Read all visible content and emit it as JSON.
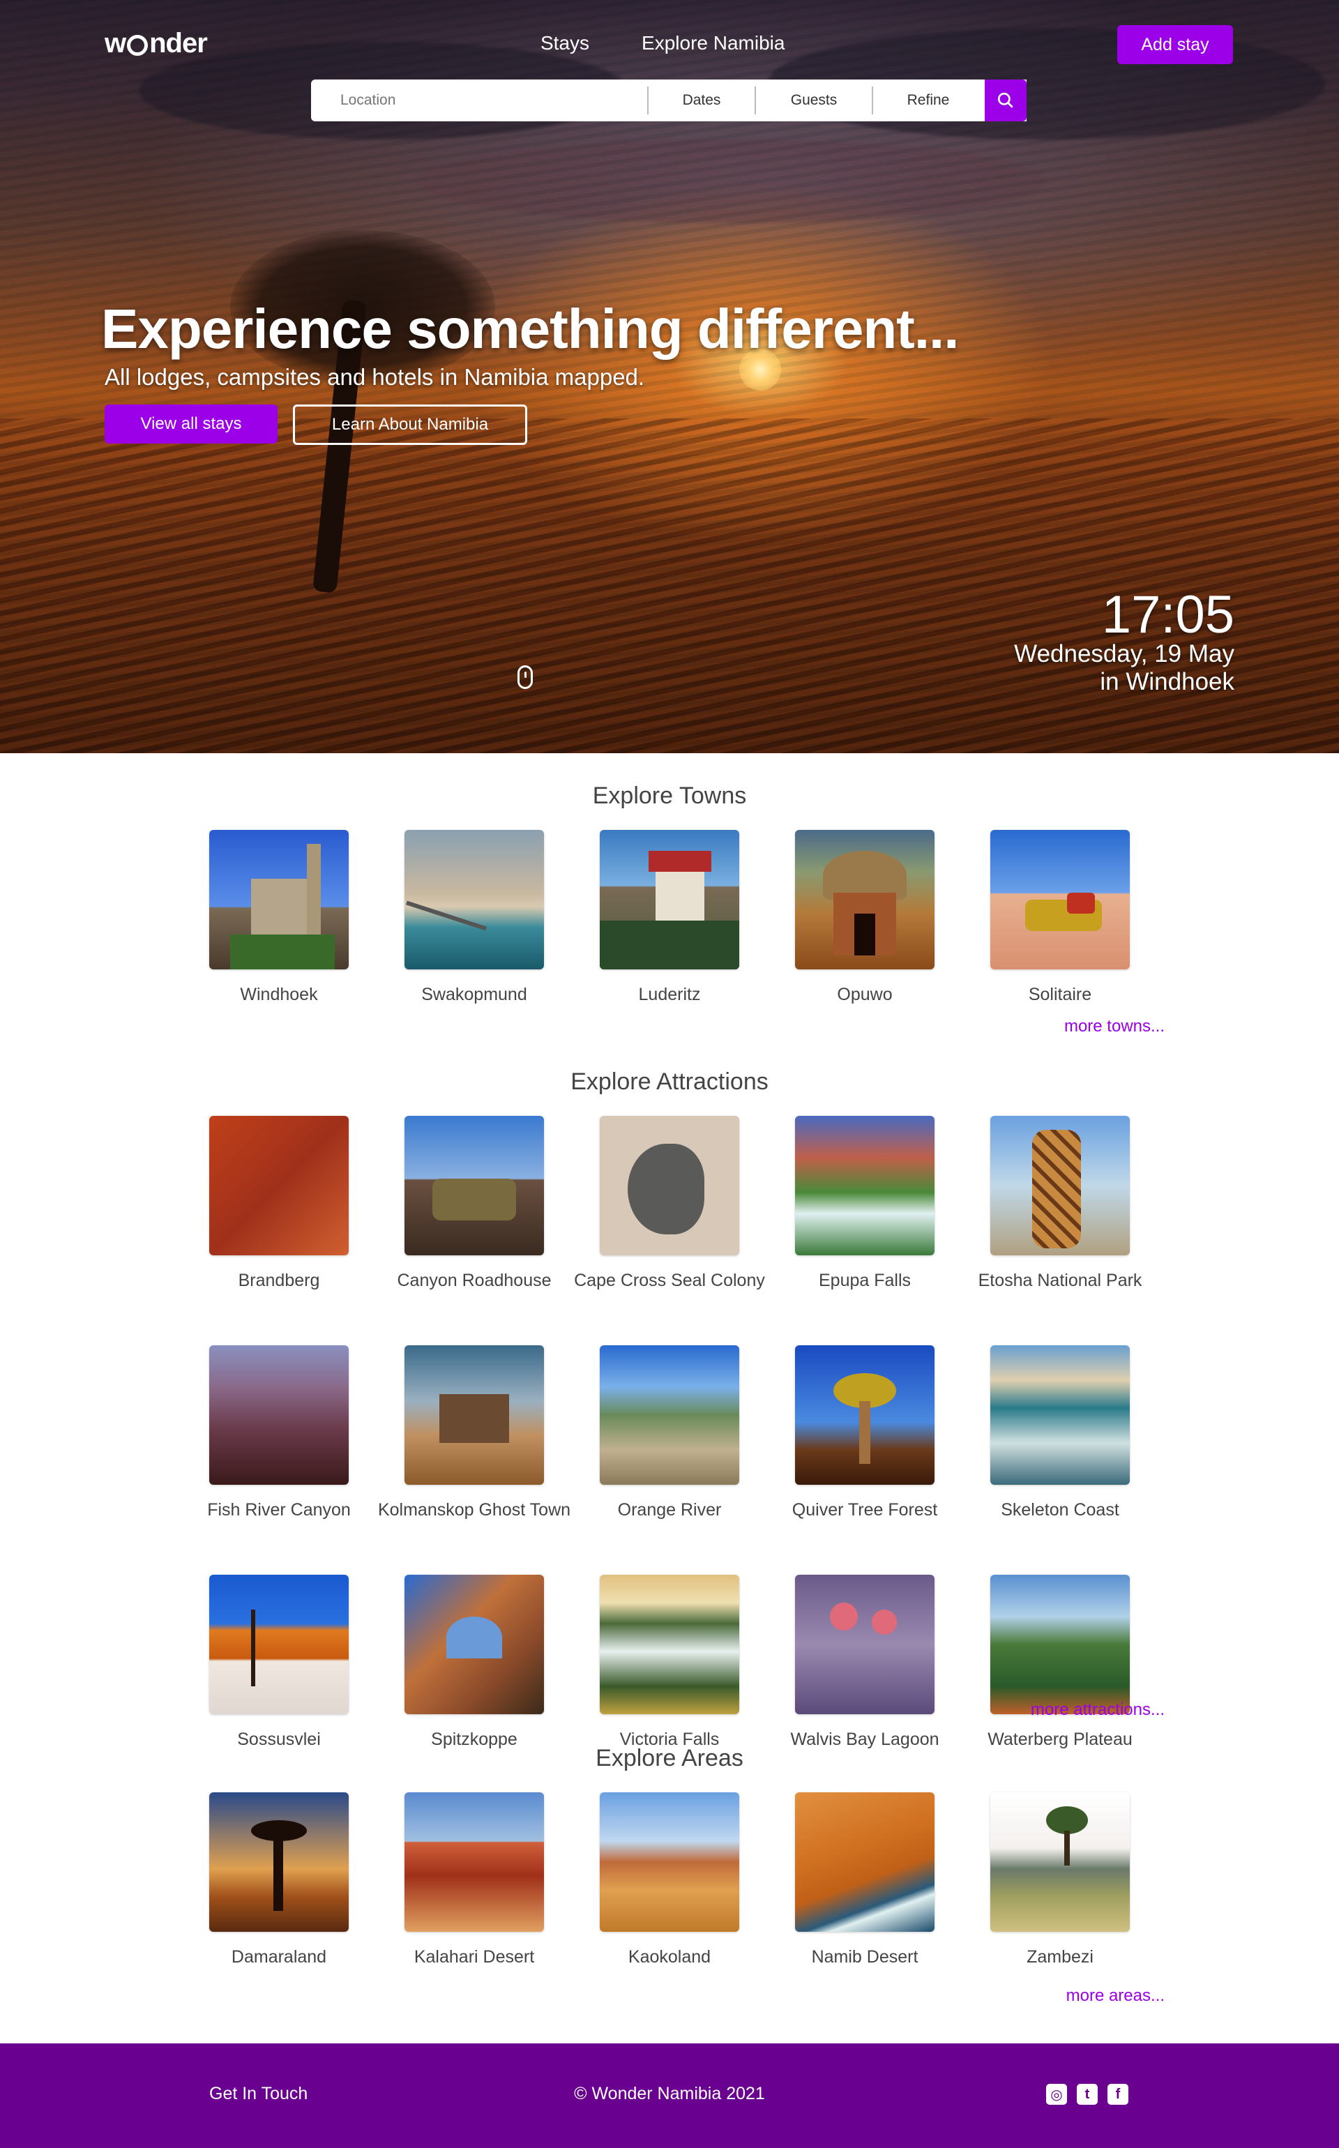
{
  "header": {
    "logo_text": "wonder",
    "nav": [
      "Stays",
      "Explore Namibia"
    ],
    "add_stay": "Add stay"
  },
  "search": {
    "location_placeholder": "Location",
    "dates": "Dates",
    "guests": "Guests",
    "refine": "Refine"
  },
  "hero": {
    "title": "Experience something different...",
    "subtitle": "All lodges, campsites and hotels in Namibia mapped.",
    "primary_button": "View all stays",
    "secondary_button": "Learn About Namibia",
    "time": "17:05",
    "date": "Wednesday, 19 May",
    "city": "in Windhoek"
  },
  "towns": {
    "title": "Explore Towns",
    "items": [
      "Windhoek",
      "Swakopmund",
      "Luderitz",
      "Opuwo",
      "Solitaire"
    ],
    "more": "more towns..."
  },
  "attractions": {
    "title": "Explore Attractions",
    "items": [
      "Brandberg",
      "Canyon Roadhouse",
      "Cape Cross Seal Colony",
      "Epupa Falls",
      "Etosha National Park",
      "Fish River Canyon",
      "Kolmanskop Ghost Town",
      "Orange River",
      "Quiver Tree Forest",
      "Skeleton Coast",
      "Sossusvlei",
      "Spitzkoppe",
      "Victoria Falls",
      "Walvis Bay Lagoon",
      "Waterberg Plateau"
    ],
    "more": "more attractions..."
  },
  "areas": {
    "title": "Explore Areas",
    "items": [
      "Damaraland",
      "Kalahari Desert",
      "Kaokoland",
      "Namib Desert",
      "Zambezi"
    ],
    "more": "more areas..."
  },
  "footer": {
    "contact": "Get In Touch",
    "copyright": "© Wonder Namibia 2021",
    "social": [
      "instagram-icon",
      "twitter-icon",
      "facebook-icon"
    ]
  },
  "colors": {
    "accent": "#9b00e8",
    "footer": "#6a008f"
  }
}
